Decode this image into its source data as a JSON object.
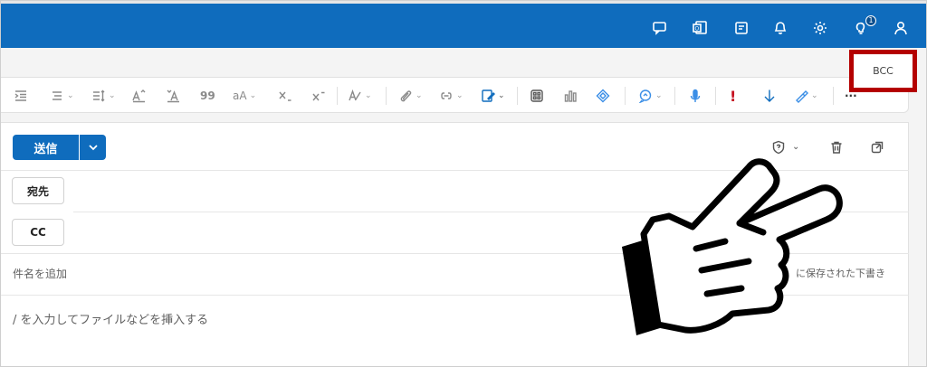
{
  "header": {
    "icons": [
      "chat-icon",
      "outlook-icon",
      "notes-icon",
      "bell-icon",
      "gear-icon",
      "lightbulb-icon",
      "person-icon"
    ],
    "tips_badge": "1"
  },
  "toolbar": {
    "icons": [
      "indent-icon",
      "bullets-icon",
      "line-spacing-icon",
      "font-grow-icon",
      "font-shrink-icon",
      "quote-icon",
      "case-icon",
      "subscript-icon",
      "superscript-icon",
      "styles-icon",
      "attach-icon",
      "link-icon",
      "signature-icon",
      "apps-icon",
      "poll-icon",
      "loop-icon",
      "editor-icon",
      "dictate-icon",
      "importance-high-icon",
      "importance-low-icon",
      "sensitivity-icon",
      "more-icon"
    ],
    "font_case_label": "aA",
    "quote_label": "99",
    "more_label": "···"
  },
  "compose": {
    "send_label": "送信",
    "to_label": "宛先",
    "cc_label": "CC",
    "bcc_label": "BCC",
    "subject_placeholder": "件名を追加",
    "draft_status": "に保存された下書き",
    "body_placeholder": "/ を入力してファイルなどを挿入する"
  }
}
